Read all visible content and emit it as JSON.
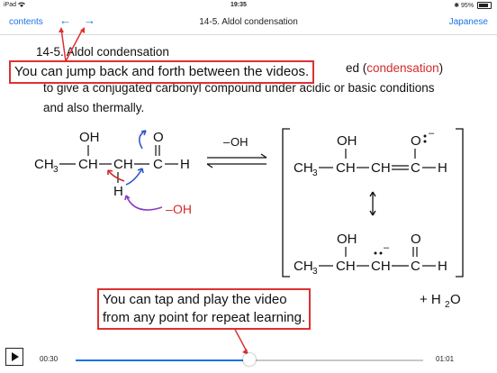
{
  "status": {
    "device": "iPad",
    "wifi_icon": "wifi-icon",
    "time": "19:35",
    "battery": "95%"
  },
  "nav": {
    "contents_label": "contents",
    "back_arrow": "←",
    "forward_arrow": "→",
    "title": "14-5. Aldol condensation",
    "language_label": "Japanese"
  },
  "content": {
    "heading": "14-5. Aldol condensation",
    "line1_end": "ed (",
    "line1_red": "condensation",
    "line1_close": ")",
    "line2": "to give a conjugated carbonyl compound under acidic or basic conditions",
    "line3": "and also thermally."
  },
  "scheme": {
    "oh": "OH",
    "ch3": "CH",
    "sub3": "3",
    "ch": "CH",
    "c": "C",
    "h": "H",
    "o": "O",
    "hydroxide": "OH",
    "hydroxide_charge": "–",
    "plus_water": "+ H",
    "sub2": "2",
    "water_o": "O",
    "arrow_color": "#3355cc",
    "red_arrow_color": "#d42a2a",
    "purple_color": "#8a3fc8"
  },
  "callouts": {
    "top": "You can jump back and forth between the videos.",
    "bottom_line1": "You can tap and play the video",
    "bottom_line2": "from any point for repeat learning.",
    "border_color": "#e03030"
  },
  "player": {
    "current_time": "00:30",
    "total_time": "01:01",
    "progress": 0.5
  }
}
